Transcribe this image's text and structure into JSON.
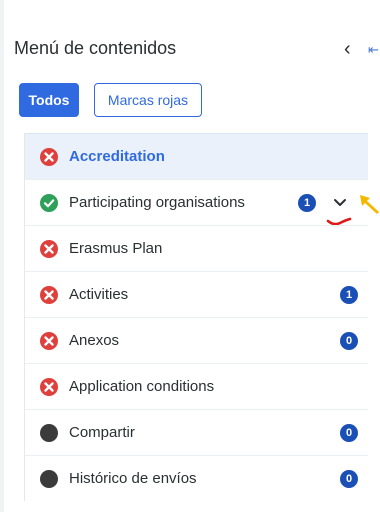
{
  "header": {
    "title": "Menú de contenidos",
    "collapse_icon": "chevron-left-icon",
    "expand_icon": "arrow-expand-icon"
  },
  "filters": {
    "all_label": "Todos",
    "red_marks_label": "Marcas rojas",
    "selected": "Todos"
  },
  "colors": {
    "accent": "#2f6ae0",
    "error": "#e0403c",
    "success": "#2ea05a",
    "neutral": "#3b3b3b",
    "badge": "#1a4fb5",
    "annotation_arrow": "#f5b800",
    "annotation_underline": "#e01818"
  },
  "items": [
    {
      "label": "Accreditation",
      "status": "error",
      "active": true
    },
    {
      "label": "Participating organisations",
      "status": "success",
      "count": "1",
      "expandable": true
    },
    {
      "label": "Erasmus Plan",
      "status": "error"
    },
    {
      "label": "Activities",
      "status": "error",
      "count": "1"
    },
    {
      "label": "Anexos",
      "status": "error",
      "count": "0"
    },
    {
      "label": "Application conditions",
      "status": "error"
    },
    {
      "label": "Compartir",
      "status": "neutral",
      "count": "0"
    },
    {
      "label": "Histórico de envíos",
      "status": "neutral",
      "count": "0"
    }
  ]
}
